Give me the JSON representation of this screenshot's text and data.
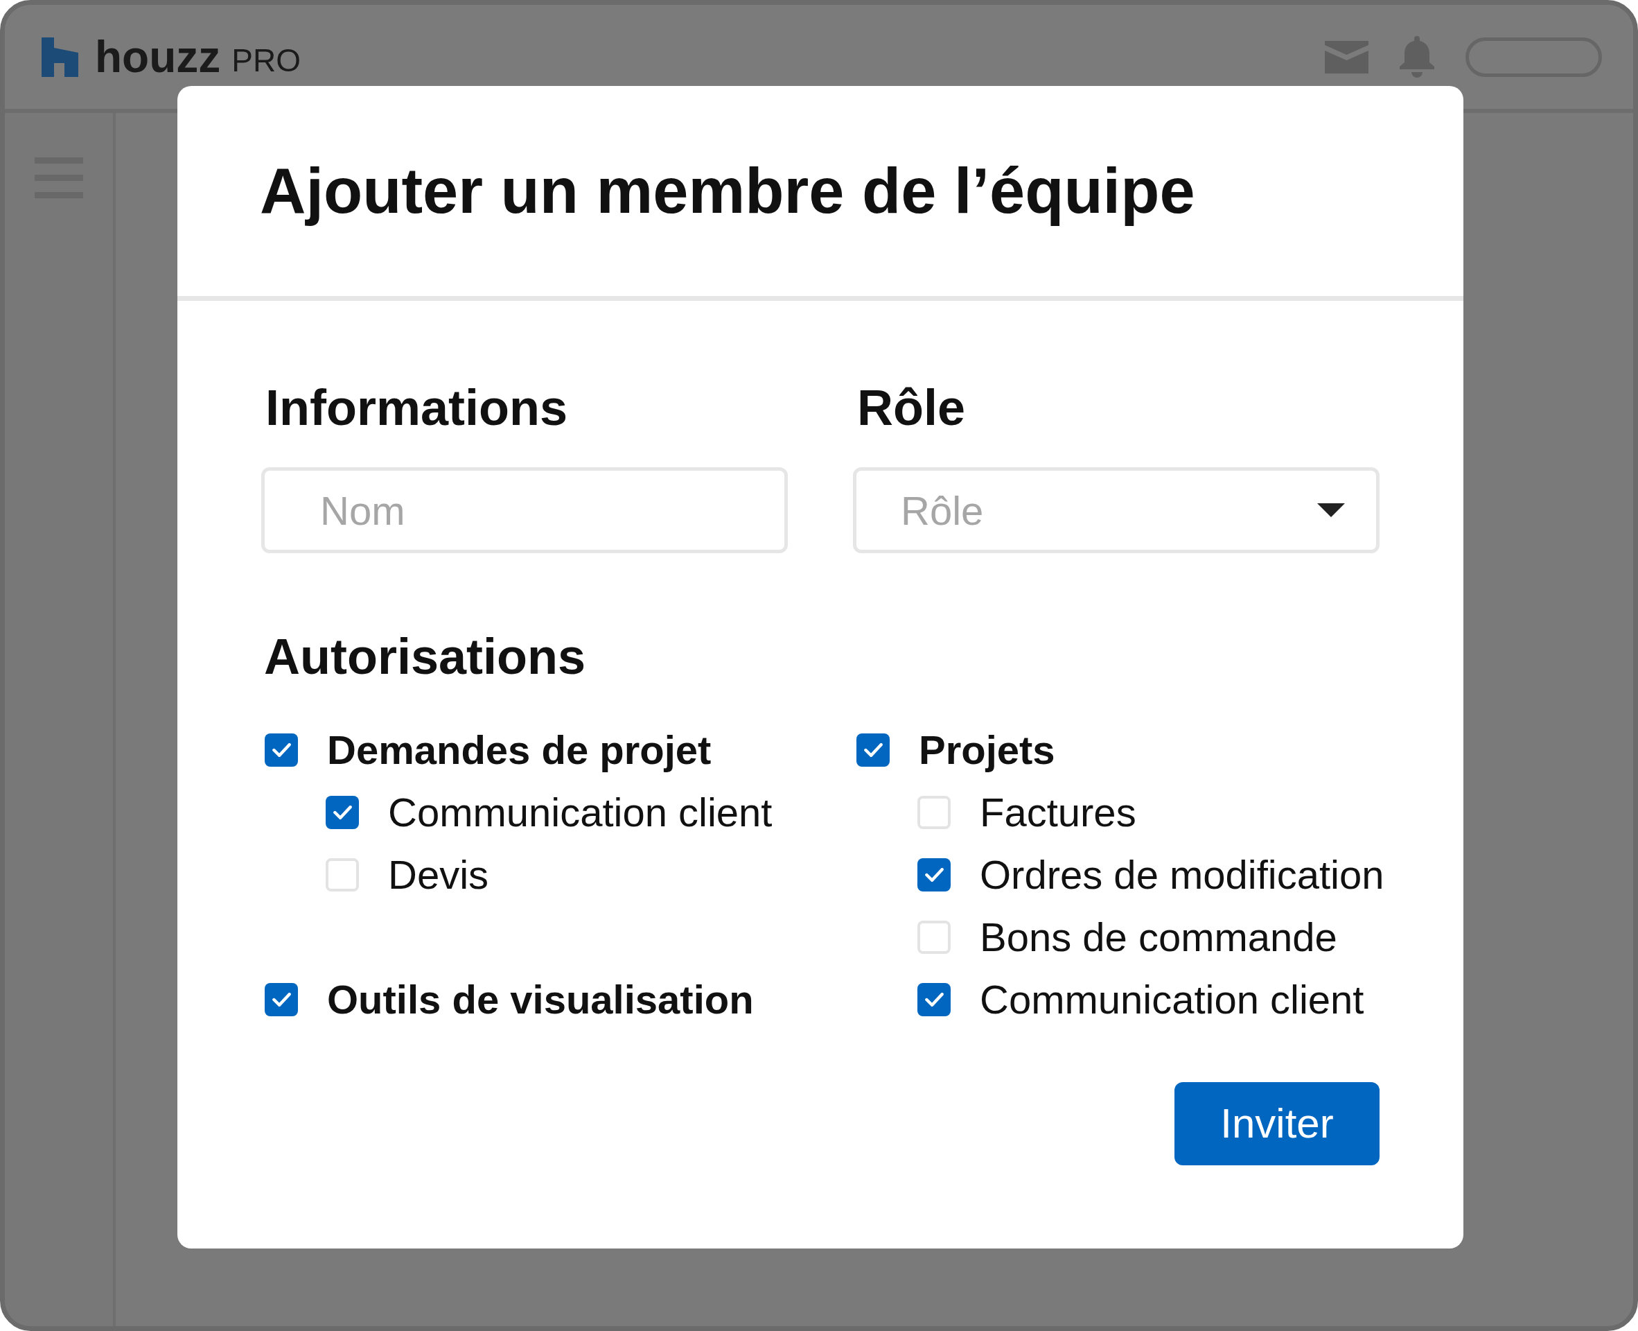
{
  "header": {
    "brand": "houzz",
    "product": "PRO"
  },
  "dialog": {
    "title": "Ajouter un membre de l’équipe",
    "fields": [
      {
        "heading": "Informations",
        "kind": "text",
        "placeholder": "Nom"
      },
      {
        "heading": "Rôle",
        "kind": "select",
        "placeholder": "Rôle"
      }
    ],
    "permissions": {
      "heading": "Autorisations",
      "columns": [
        {
          "groups": [
            {
              "label": "Demandes de projet",
              "checked": true,
              "children": [
                {
                  "label": "Communication client",
                  "checked": true
                },
                {
                  "label": "Devis",
                  "checked": false
                }
              ]
            },
            {
              "label": "Outils de visualisation",
              "checked": true
            }
          ]
        },
        {
          "groups": [
            {
              "label": "Projets",
              "checked": true,
              "children": [
                {
                  "label": "Factures",
                  "checked": false
                },
                {
                  "label": "Ordres de modification",
                  "checked": true
                },
                {
                  "label": "Bons de commande",
                  "checked": false
                },
                {
                  "label": "Communication client",
                  "checked": true
                }
              ]
            }
          ]
        }
      ]
    },
    "submit": "Inviter"
  }
}
